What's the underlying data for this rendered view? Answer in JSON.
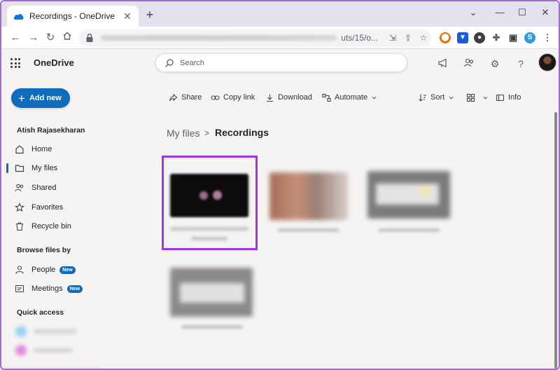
{
  "browser": {
    "tab_title": "Recordings - OneDrive",
    "url_visible_fragment": "uts/15/o...",
    "window_controls": [
      "minimize",
      "maximize",
      "close"
    ],
    "colors": {
      "accent": "#a26bd1"
    }
  },
  "app": {
    "brand": "OneDrive",
    "search_placeholder": "Search",
    "header_icons": [
      "megaphone-icon",
      "people-icon",
      "gear-icon",
      "help-icon"
    ]
  },
  "sidebar": {
    "add_new_label": "Add new",
    "user_name": "Atish Rajasekharan",
    "items": [
      {
        "label": "Home",
        "icon": "home-icon"
      },
      {
        "label": "My files",
        "icon": "folder-icon",
        "selected": true
      },
      {
        "label": "Shared",
        "icon": "people-icon"
      },
      {
        "label": "Favorites",
        "icon": "star-icon"
      },
      {
        "label": "Recycle bin",
        "icon": "trash-icon"
      }
    ],
    "browse_heading": "Browse files by",
    "browse_items": [
      {
        "label": "People",
        "badge": "New",
        "icon": "person-icon"
      },
      {
        "label": "Meetings",
        "badge": "New",
        "icon": "meetings-icon"
      }
    ],
    "quick_access_heading": "Quick access"
  },
  "commandbar": {
    "share": "Share",
    "copy_link": "Copy link",
    "download": "Download",
    "automate": "Automate",
    "sort": "Sort",
    "info": "Info"
  },
  "breadcrumb": {
    "parent": "My files",
    "separator": ">",
    "current": "Recordings"
  },
  "files": {
    "tiles": 4,
    "highlighted_index": 0,
    "highlight_color": "#a237d9"
  }
}
